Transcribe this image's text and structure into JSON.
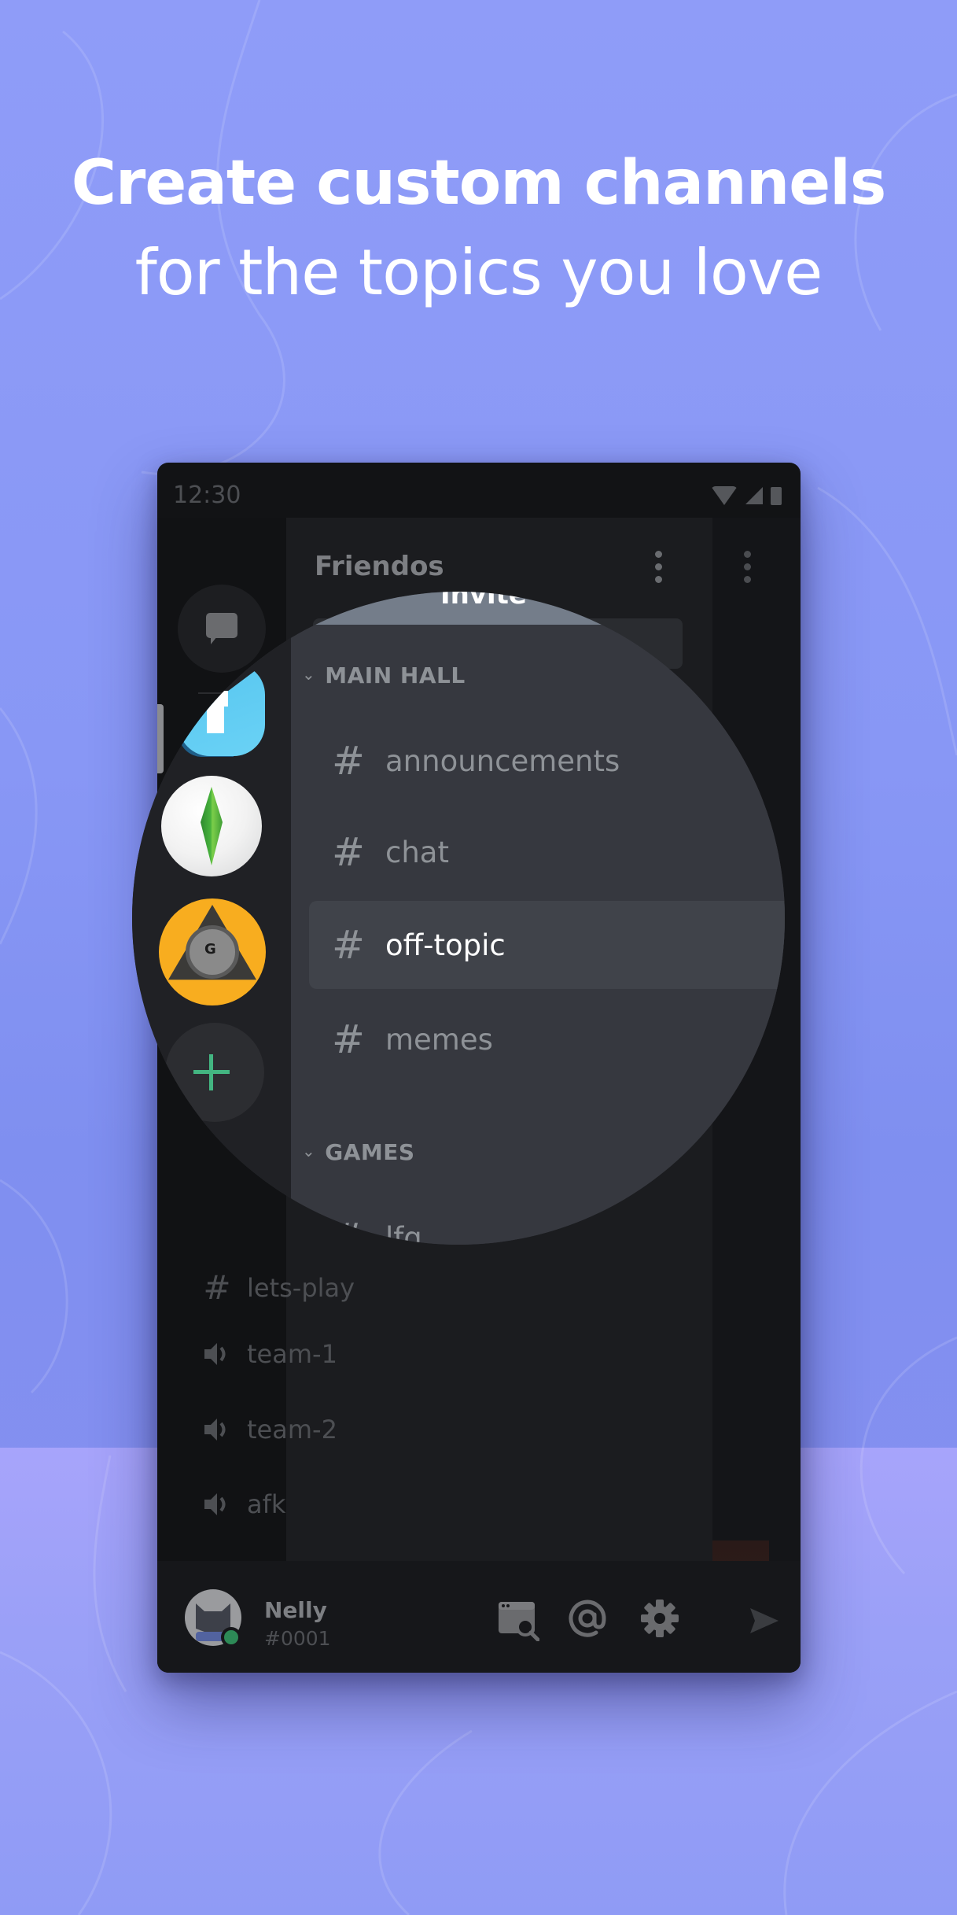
{
  "headline": {
    "line1": "Create custom channels",
    "line2": "for the topics you love"
  },
  "statusbar": {
    "time": "12:30",
    "icons": [
      "wifi-icon",
      "signal-icon",
      "battery-icon"
    ]
  },
  "server": {
    "name": "Friendos",
    "invite_label": "Invite",
    "menu_icon": "more-vertical-icon"
  },
  "guilds": [
    {
      "name": "direct-messages",
      "icon": "chat-bubble-icon"
    },
    {
      "name": "blue-server",
      "icon": "server-icon"
    },
    {
      "name": "sims-server",
      "icon": "plumbob-icon"
    },
    {
      "name": "yellow-server",
      "icon": "server-icon"
    },
    {
      "name": "add-server",
      "icon": "plus-icon"
    }
  ],
  "categories": [
    {
      "name": "MAIN HALL",
      "channels": [
        {
          "name": "announcements",
          "type": "text",
          "selected": false
        },
        {
          "name": "chat",
          "type": "text",
          "selected": false
        },
        {
          "name": "off-topic",
          "type": "text",
          "selected": true
        },
        {
          "name": "memes",
          "type": "text",
          "selected": false
        }
      ]
    },
    {
      "name": "GAMES",
      "channels": [
        {
          "name": "lfg",
          "type": "text"
        },
        {
          "name": "lets-play",
          "type": "text"
        },
        {
          "name": "team-1",
          "type": "voice"
        },
        {
          "name": "team-2",
          "type": "voice"
        },
        {
          "name": "afk",
          "type": "voice"
        }
      ]
    }
  ],
  "user": {
    "name": "Nelly",
    "tag": "#0001",
    "status": "online",
    "actions": [
      "server-discovery-icon",
      "mention-icon",
      "settings-icon"
    ]
  },
  "colors": {
    "background": "#8f9cf8",
    "online": "#2d8a57",
    "add_server": "#43b581",
    "magnifier": "#36383f"
  }
}
